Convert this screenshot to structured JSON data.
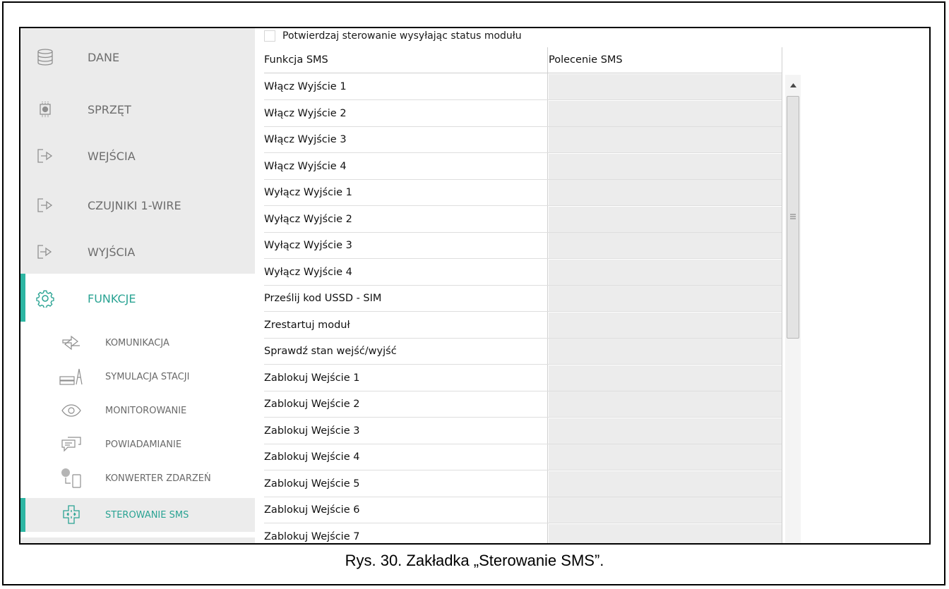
{
  "sidebar": {
    "items": [
      {
        "label": "DANE",
        "icon": "database-icon"
      },
      {
        "label": "SPRZĘT",
        "icon": "chip-icon"
      },
      {
        "label": "WEJŚCIA",
        "icon": "input-arrow-icon"
      },
      {
        "label": "CZUJNIKI 1-WIRE",
        "icon": "input-arrow-icon"
      },
      {
        "label": "WYJŚCIA",
        "icon": "output-arrow-icon"
      },
      {
        "label": "FUNKCJE",
        "icon": "gear-icon",
        "active": true
      }
    ],
    "subitems": [
      {
        "label": "KOMUNIKACJA",
        "icon": "communication-arrows-icon"
      },
      {
        "label": "SYMULACJA STACJI",
        "icon": "station-icon"
      },
      {
        "label": "MONITOROWANIE",
        "icon": "eye-icon"
      },
      {
        "label": "POWIADAMIANIE",
        "icon": "chat-bubble-icon"
      },
      {
        "label": "KONWERTER ZDARZEŃ",
        "icon": "converter-icon"
      },
      {
        "label": "STEROWANIE SMS",
        "icon": "sms-control-icon",
        "active": true
      }
    ]
  },
  "confirm": {
    "label": "Potwierdzaj sterowanie wysyłając status modułu",
    "checked": false
  },
  "table": {
    "headers": [
      "Funkcja SMS",
      "Polecenie SMS"
    ],
    "rows": [
      "Włącz Wyjście 1",
      "Włącz Wyjście 2",
      "Włącz Wyjście 3",
      "Włącz Wyjście 4",
      "Wyłącz Wyjście 1",
      "Wyłącz Wyjście 2",
      "Wyłącz Wyjście 3",
      "Wyłącz Wyjście 4",
      "Prześlij kod USSD - SIM",
      "Zrestartuj moduł",
      "Sprawdź stan wejść/wyjść",
      "Zablokuj Wejście 1",
      "Zablokuj Wejście 2",
      "Zablokuj Wejście 3",
      "Zablokuj Wejście 4",
      "Zablokuj Wejście 5",
      "Zablokuj Wejście 6",
      "Zablokuj Wejście 7"
    ]
  },
  "caption": "Rys. 30. Zakładka „Sterowanie SMS”.",
  "colors": {
    "accent": "#2db6a3",
    "sidebar_bg": "#ebebeb"
  }
}
